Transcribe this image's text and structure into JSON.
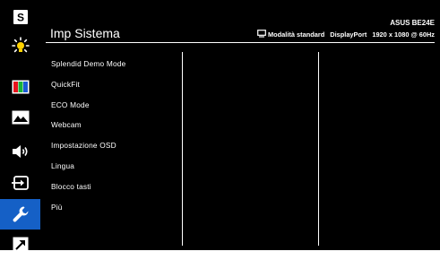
{
  "sidebar": {
    "items": [
      {
        "name": "splendid",
        "icon": "splendid-s-icon",
        "active": false
      },
      {
        "name": "blue-light-filter",
        "icon": "blue-light-filter-icon",
        "active": false
      },
      {
        "name": "color",
        "icon": "color-bars-icon",
        "active": false
      },
      {
        "name": "image",
        "icon": "image-icon",
        "active": false
      },
      {
        "name": "sound",
        "icon": "speaker-icon",
        "active": false
      },
      {
        "name": "input-select",
        "icon": "input-select-icon",
        "active": false
      },
      {
        "name": "system-setup",
        "icon": "wrench-icon",
        "active": true
      },
      {
        "name": "shortcut",
        "icon": "shortcut-arrow-icon",
        "active": false
      }
    ],
    "active_color": "#1560c6"
  },
  "header": {
    "title": "Imp Sistema",
    "model": "ASUS BE24E",
    "mode": "Modalità standard",
    "input": "DisplayPort",
    "resolution": "1920 x 1080 @ 60Hz"
  },
  "menu": {
    "items": [
      "Splendid Demo Mode",
      "QuickFit",
      "ECO Mode",
      "Webcam",
      "Impostazione OSD",
      "Lingua",
      "Blocco tasti",
      "Più"
    ]
  }
}
